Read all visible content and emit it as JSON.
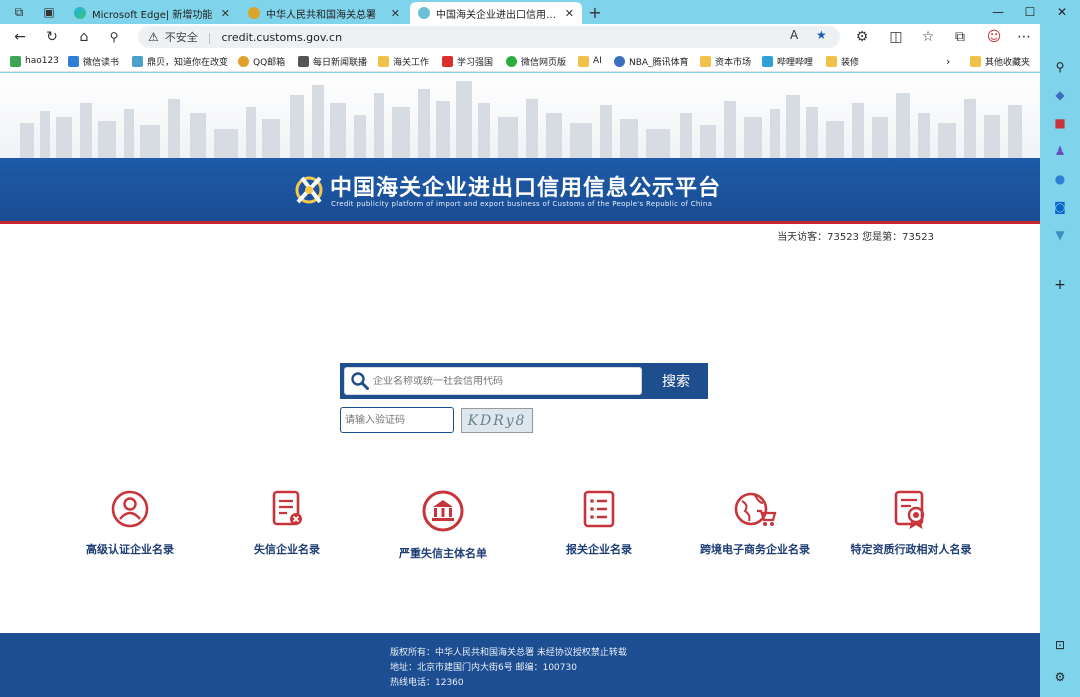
{
  "browser": {
    "tabs": [
      {
        "label": "Microsoft Edge| 新增功能",
        "active": false
      },
      {
        "label": "中华人民共和国海关总署",
        "active": false
      },
      {
        "label": "中国海关企业进出口信用信息公示",
        "active": true
      }
    ],
    "new_tab_label": "+",
    "address": {
      "security": "不安全",
      "url": "credit.customs.gov.cn"
    },
    "bookmarks": [
      "hao123",
      "微信读书",
      "鼎贝，知道你在改变",
      "QQ邮箱",
      "每日新闻联播",
      "海关工作",
      "学习强国",
      "微信网页版",
      "AI",
      "NBA_腾讯体育",
      "资本市场",
      "哔哩哔哩",
      "装修"
    ],
    "bookmarks_other": "其他收藏夹"
  },
  "page": {
    "title": "中国海关企业进出口信用信息公示平台",
    "subtitle": "Credit publicity platform of import and export business of Customs of the People's Republic of China",
    "visitors": "当天访客：73523   您是第：73523",
    "search": {
      "placeholder": "企业名称或统一社会信用代码",
      "button": "搜索",
      "captcha_placeholder": "请输入验证码",
      "captcha_text": "KDRy8"
    },
    "categories": [
      {
        "label": "高级认证企业名录",
        "icon": "person-icon"
      },
      {
        "label": "失信企业名录",
        "icon": "document-x-icon"
      },
      {
        "label": "严重失信主体名单",
        "icon": "bank-icon"
      },
      {
        "label": "报关企业名录",
        "icon": "list-icon"
      },
      {
        "label": "跨境电子商务企业名录",
        "icon": "globe-cart-icon"
      },
      {
        "label": "特定资质行政相对人名录",
        "icon": "certificate-icon"
      }
    ],
    "footer": {
      "copyright": "版权所有：中华人民共和国海关总署   未经协议授权禁止转载",
      "address": "地址：北京市建国门内大街6号 邮编：100730",
      "hotline": "热线电话：12360"
    }
  },
  "colors": {
    "accent": "#1f4e8f",
    "icon_red": "#c7343a",
    "chrome": "#7fd3ea"
  }
}
